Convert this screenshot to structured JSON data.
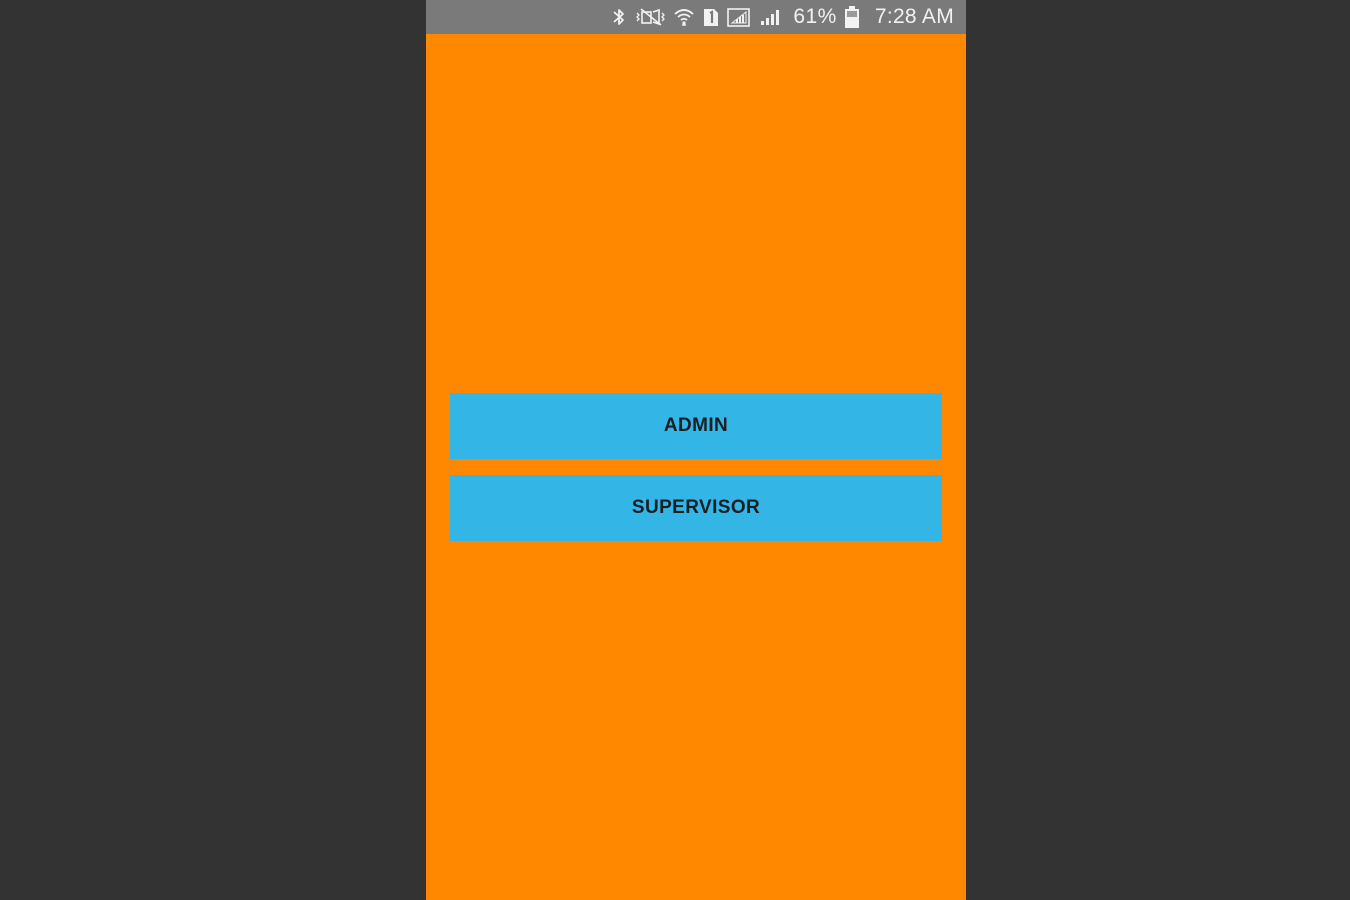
{
  "status_bar": {
    "battery_percent": "61%",
    "time": "7:28 AM",
    "icons": [
      "bluetooth-icon",
      "vibrate-mute-icon",
      "wifi-icon",
      "sim-1-icon",
      "signal-outline-icon",
      "signal-icon",
      "battery-icon"
    ]
  },
  "screen": {
    "background_color": "#FF8800",
    "buttons": [
      {
        "label": "ADMIN"
      },
      {
        "label": "SUPERVISOR"
      }
    ],
    "button_color": "#33B5E5"
  }
}
